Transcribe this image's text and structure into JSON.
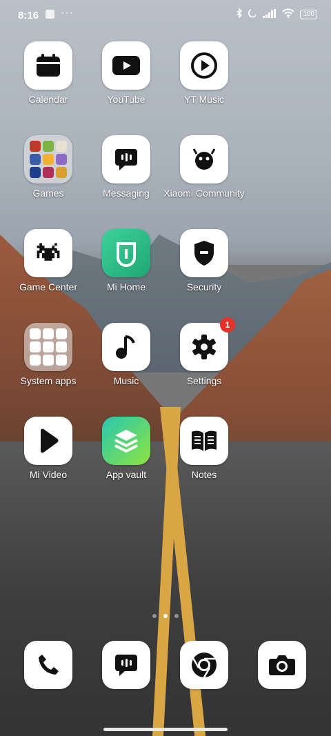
{
  "status": {
    "time": "8:16",
    "dots": "···",
    "battery": "100",
    "icons": [
      "bluetooth-icon",
      "moon-icon",
      "signal-icon",
      "wifi-icon",
      "battery-icon"
    ]
  },
  "apps": [
    {
      "label": "Calendar",
      "icon": "calendar-icon"
    },
    {
      "label": "YouTube",
      "icon": "youtube-icon"
    },
    {
      "label": "YT Music",
      "icon": "play-circle-icon"
    },
    {
      "label": "Games",
      "icon": "folder-icon"
    },
    {
      "label": "Messaging",
      "icon": "chat-bubble-icon"
    },
    {
      "label": "Xiaomi Community",
      "icon": "xiaomi-community-icon"
    },
    {
      "label": "Game Center",
      "icon": "space-invader-icon"
    },
    {
      "label": "Mi Home",
      "icon": "mi-home-icon"
    },
    {
      "label": "Security",
      "icon": "shield-icon"
    },
    {
      "label": "System apps",
      "icon": "folder-icon"
    },
    {
      "label": "Music",
      "icon": "music-note-icon"
    },
    {
      "label": "Settings",
      "icon": "gear-icon",
      "badge": "1"
    },
    {
      "label": "Mi Video",
      "icon": "play-icon"
    },
    {
      "label": "App vault",
      "icon": "stack-icon"
    },
    {
      "label": "Notes",
      "icon": "book-icon"
    }
  ],
  "dock": [
    {
      "name": "phone",
      "icon": "phone-icon"
    },
    {
      "name": "messages",
      "icon": "chat-bubble-icon"
    },
    {
      "name": "chrome",
      "icon": "chrome-icon"
    },
    {
      "name": "camera",
      "icon": "camera-icon"
    }
  ],
  "colors": {
    "badge": "#e4322b",
    "mi_home": "#2fbf8a",
    "app_vault": "#7ed957"
  }
}
